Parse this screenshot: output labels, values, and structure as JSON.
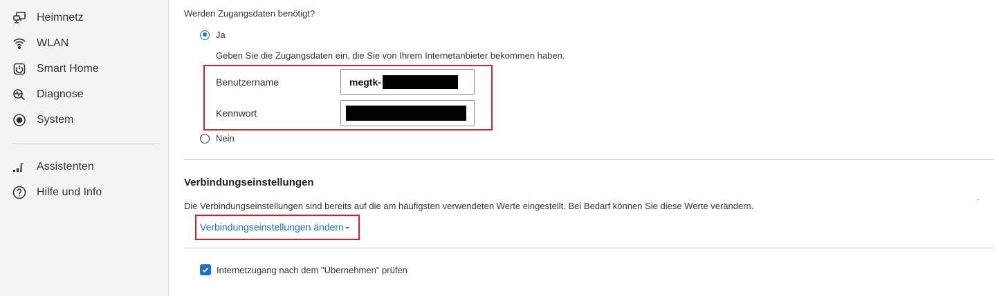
{
  "sidebar": {
    "items": [
      {
        "label": "Heimnetz",
        "icon": "network-icon"
      },
      {
        "label": "WLAN",
        "icon": "wifi-icon"
      },
      {
        "label": "Smart Home",
        "icon": "smart-home-icon"
      },
      {
        "label": "Diagnose",
        "icon": "diagnose-icon"
      },
      {
        "label": "System",
        "icon": "system-icon"
      }
    ],
    "bottom_items": [
      {
        "label": "Assistenten",
        "icon": "wizard-icon"
      },
      {
        "label": "Hilfe und Info",
        "icon": "help-icon"
      }
    ]
  },
  "credentials": {
    "question": "Werden Zugangsdaten benötigt?",
    "yes_label": "Ja",
    "yes_selected": true,
    "hint": "Geben Sie die Zugangsdaten ein, die Sie von Ihrem Internetanbieter bekommen haben.",
    "username_label": "Benutzername",
    "username_value": "megtk-",
    "password_label": "Kennwort",
    "no_label": "Nein"
  },
  "connection": {
    "heading": "Verbindungseinstellungen",
    "description": "Die Verbindungseinstellungen sind bereits auf die am häufigsten verwendeten Werte eingestellt. Bei Bedarf können Sie diese Werte verändern.",
    "change_link": "Verbindungseinstellungen ändern",
    "stray_mark": "."
  },
  "check": {
    "label": "Internetzugang nach dem \"Übernehmen\" prüfen",
    "checked": true
  },
  "colors": {
    "accent": "#1a73c8",
    "highlight_border": "#d32030",
    "sidebar_bg": "#f4f4f4"
  }
}
